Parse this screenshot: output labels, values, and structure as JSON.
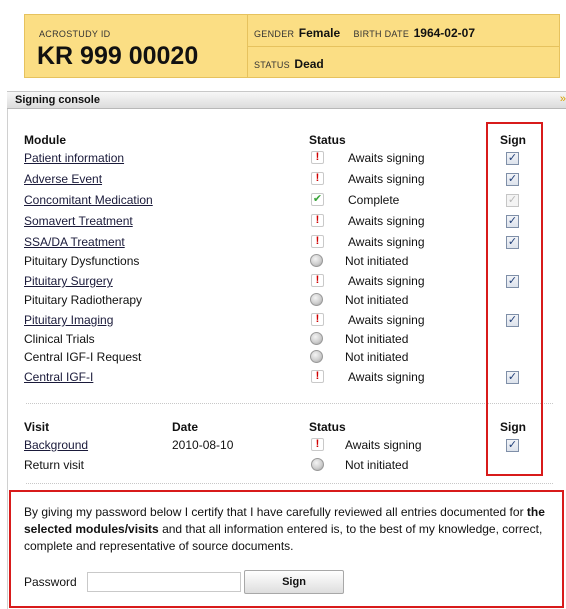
{
  "header": {
    "id_label": "ACROSTUDY ID",
    "id_value": "KR 999 00020",
    "gender_label": "GENDER",
    "gender_value": "Female",
    "birth_label": "BIRTH DATE",
    "birth_value": "1964-02-07",
    "status_label": "STATUS",
    "status_value": "Dead"
  },
  "console": {
    "title": "Signing console"
  },
  "modules": {
    "col_module": "Module",
    "col_status": "Status",
    "col_sign": "Sign",
    "rows": [
      {
        "name": "Patient information",
        "link": true,
        "icon": "warn",
        "status": "Awaits signing",
        "sign": "checked"
      },
      {
        "name": "Adverse Event",
        "link": true,
        "icon": "warn",
        "status": "Awaits signing",
        "sign": "checked"
      },
      {
        "name": "Concomitant Medication",
        "link": true,
        "icon": "ok",
        "status": "Complete",
        "sign": "disabled"
      },
      {
        "name": "Somavert Treatment",
        "link": true,
        "icon": "warn",
        "status": "Awaits signing",
        "sign": "checked"
      },
      {
        "name": "SSA/DA Treatment",
        "link": true,
        "icon": "warn",
        "status": "Awaits signing",
        "sign": "checked"
      },
      {
        "name": "Pituitary Dysfunctions",
        "link": false,
        "icon": "ni",
        "status": "Not initiated",
        "sign": "none"
      },
      {
        "name": "Pituitary Surgery",
        "link": true,
        "icon": "warn",
        "status": "Awaits signing",
        "sign": "checked"
      },
      {
        "name": "Pituitary Radiotherapy",
        "link": false,
        "icon": "ni",
        "status": "Not initiated",
        "sign": "none"
      },
      {
        "name": "Pituitary Imaging",
        "link": true,
        "icon": "warn",
        "status": "Awaits signing",
        "sign": "checked"
      },
      {
        "name": "Clinical Trials",
        "link": false,
        "icon": "ni",
        "status": "Not initiated",
        "sign": "none"
      },
      {
        "name": "Central IGF-I Request",
        "link": false,
        "icon": "ni",
        "status": "Not initiated",
        "sign": "none"
      },
      {
        "name": "Central IGF-I",
        "link": true,
        "icon": "warn",
        "status": "Awaits signing",
        "sign": "checked"
      }
    ]
  },
  "visits": {
    "col_visit": "Visit",
    "col_date": "Date",
    "col_status": "Status",
    "col_sign": "Sign",
    "rows": [
      {
        "name": "Background",
        "link": true,
        "date": "2010-08-10",
        "icon": "warn",
        "status": "Awaits signing",
        "sign": "checked"
      },
      {
        "name": "Return visit",
        "link": false,
        "date": "",
        "icon": "ni",
        "status": "Not initiated",
        "sign": "none"
      }
    ]
  },
  "certify": {
    "text_pre": "By giving my password below I certify that I have carefully reviewed all entries documented for ",
    "text_bold": "the selected modules/visits",
    "text_post": " and that all information entered is, to the best of my knowledge, correct, complete and representative of source documents.",
    "password_label": "Password",
    "password_value": "",
    "sign_button": "Sign"
  },
  "colors": {
    "header_bg": "#fbde84",
    "highlight": "#d81b1b",
    "warn": "#d00000",
    "ok": "#3aa43a"
  },
  "icons": {
    "warn": "exclamation-icon",
    "ok": "checkmark-icon",
    "ni": "gray-circle-icon"
  }
}
